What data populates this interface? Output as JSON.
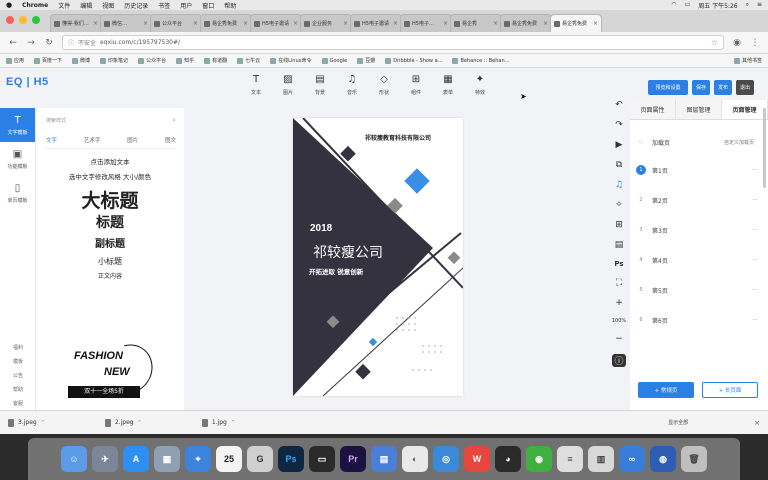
{
  "menubar": {
    "apple": "",
    "items": [
      "Chrome",
      "文件",
      "编辑",
      "视图",
      "历史记录",
      "书签",
      "用户",
      "窗口",
      "帮助"
    ],
    "clock": "周五 下午5:26"
  },
  "tabs": [
    {
      "label": "懂得-我们…"
    },
    {
      "label": "微信…"
    },
    {
      "label": "公众平台"
    },
    {
      "label": "易企秀免费"
    },
    {
      "label": "H5电子邀请"
    },
    {
      "label": "企业服务"
    },
    {
      "label": "H5电子邀请"
    },
    {
      "label": "H5电子…"
    },
    {
      "label": "易企秀"
    },
    {
      "label": "易企秀免费"
    },
    {
      "label": "易企秀免费"
    }
  ],
  "address": {
    "secure_label": "不安全",
    "url": "eqxiu.com/c/195797530#/"
  },
  "bookmarks": [
    {
      "label": "应用"
    },
    {
      "label": "百度一下"
    },
    {
      "label": "微博"
    },
    {
      "label": "印象笔记"
    },
    {
      "label": "公众平台"
    },
    {
      "label": "知乎"
    },
    {
      "label": "有道翻"
    },
    {
      "label": "七牛云"
    },
    {
      "label": "在线Linux命令"
    },
    {
      "label": "Google"
    },
    {
      "label": "豆瓣"
    },
    {
      "label": "Dribbble - Show a..."
    },
    {
      "label": "Behance :: Behan..."
    },
    {
      "label": "其他书签"
    }
  ],
  "app": {
    "logo": "EQ | H5",
    "leftnav": [
      {
        "label": "文字模板",
        "icon": "T"
      },
      {
        "label": "功能模板",
        "icon": "▣"
      },
      {
        "label": "单页模板",
        "icon": "▯"
      }
    ],
    "leftnav_small": [
      "福利",
      "模板",
      "公告",
      "帮助",
      "客服",
      "反馈"
    ],
    "textpanel": {
      "search_placeholder": "搜索样式",
      "tabs": [
        "文字",
        "艺术字",
        "图片",
        "图文"
      ],
      "items": [
        {
          "text": "点击添加文本"
        },
        {
          "text": "选中文字修改风格 大小/颜色"
        },
        {
          "text": "大标题"
        },
        {
          "text": "标题"
        },
        {
          "text": "副标题"
        },
        {
          "text": "小标题"
        },
        {
          "text": "正文内容"
        }
      ],
      "fashion_line1": "FASHION",
      "fashion_line2": "NEW",
      "fashion_tag": "双十一全场5折"
    },
    "toolbar": [
      {
        "label": "文本",
        "icon": "T"
      },
      {
        "label": "图片",
        "icon": "▨"
      },
      {
        "label": "背景",
        "icon": "▤"
      },
      {
        "label": "音乐",
        "icon": "♫"
      },
      {
        "label": "形状",
        "icon": "◇"
      },
      {
        "label": "组件",
        "icon": "⊞"
      },
      {
        "label": "表单",
        "icon": "▦"
      },
      {
        "label": "特效",
        "icon": "✦"
      }
    ],
    "top_buttons": {
      "preview": "预览和设置",
      "save": "保存",
      "publish": "发布",
      "exit": "退出"
    },
    "canvas": {
      "company": "祁较瘦教育科技有限公司",
      "year": "2018",
      "name": "祁较瘦公司",
      "slogan": "开拓进取  锐意创新"
    },
    "side_zoom": "100%",
    "pagepanel": {
      "tabs": [
        "页面属性",
        "图层管理",
        "页面管理"
      ],
      "loading_page": "加载页",
      "loading_custom": "自定义加载页",
      "pages": [
        {
          "num": "1",
          "label": "第1页"
        },
        {
          "num": "2",
          "label": "第2页"
        },
        {
          "num": "3",
          "label": "第3页"
        },
        {
          "num": "4",
          "label": "第4页"
        },
        {
          "num": "5",
          "label": "第5页"
        },
        {
          "num": "6",
          "label": "第6页"
        }
      ],
      "add_normal": "+ 常规页",
      "add_long": "+ 长页面"
    }
  },
  "downloads": {
    "files": [
      "3.jpeg",
      "2.jpeg",
      "1.jpg"
    ],
    "show_all": "显示全部"
  },
  "dock": {
    "calendar_day": "25"
  },
  "colors": {
    "accent": "#2b80e6",
    "canvas_dark": "#35323f",
    "canvas_blue": "#3a8ee6"
  }
}
